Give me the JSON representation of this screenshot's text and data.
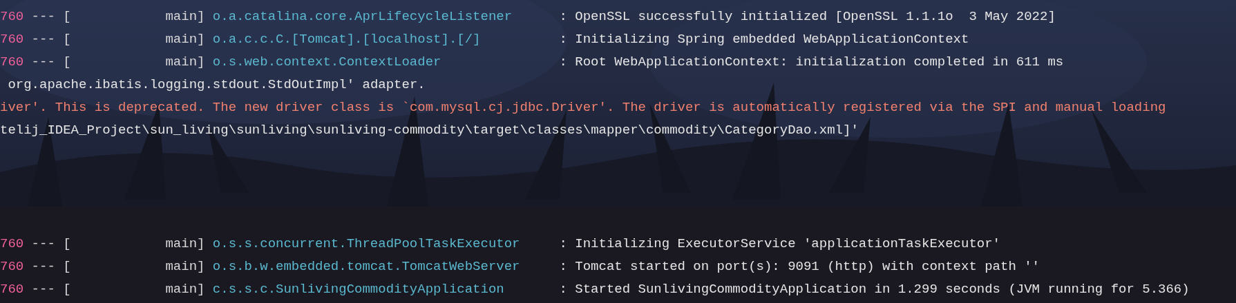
{
  "console": {
    "lines": [
      {
        "kind": "log",
        "pid": "760",
        "separator": "--- [",
        "thread": "main]",
        "logger": "o.a.catalina.core.AprLifecycleListener",
        "message": ": OpenSSL successfully initialized [OpenSSL 1.1.1o  3 May 2022]"
      },
      {
        "kind": "log",
        "pid": "760",
        "separator": "--- [",
        "thread": "main]",
        "logger": "o.a.c.c.C.[Tomcat].[localhost].[/]",
        "message": ": Initializing Spring embedded WebApplicationContext"
      },
      {
        "kind": "log",
        "pid": "760",
        "separator": "--- [",
        "thread": "main]",
        "logger": "o.s.web.context.ContextLoader",
        "message": ": Root WebApplicationContext: initialization completed in 611 ms"
      },
      {
        "kind": "plain",
        "text": " org.apache.ibatis.logging.stdout.StdOutImpl' adapter."
      },
      {
        "kind": "warn",
        "text": "iver'. This is deprecated. The new driver class is `com.mysql.cj.jdbc.Driver'. The driver is automatically registered via the SPI and manual loading"
      },
      {
        "kind": "plain",
        "text": "telij_IDEA_Project\\sun_living\\sunliving\\sunliving-commodity\\target\\classes\\mapper\\commodity\\CategoryDao.xml]'"
      },
      {
        "kind": "blank"
      },
      {
        "kind": "blank"
      },
      {
        "kind": "blank"
      },
      {
        "kind": "blank"
      },
      {
        "kind": "log",
        "pid": "760",
        "separator": "--- [",
        "thread": "main]",
        "logger": "o.s.s.concurrent.ThreadPoolTaskExecutor",
        "message": ": Initializing ExecutorService 'applicationTaskExecutor'"
      },
      {
        "kind": "log",
        "pid": "760",
        "separator": "--- [",
        "thread": "main]",
        "logger": "o.s.b.w.embedded.tomcat.TomcatWebServer",
        "message": ": Tomcat started on port(s): 9091 (http) with context path ''"
      },
      {
        "kind": "log",
        "pid": "760",
        "separator": "--- [",
        "thread": "main]",
        "logger": "c.s.s.c.SunlivingCommodityApplication",
        "message": ": Started SunlivingCommodityApplication in 1.299 seconds (JVM running for 5.366)"
      }
    ]
  }
}
